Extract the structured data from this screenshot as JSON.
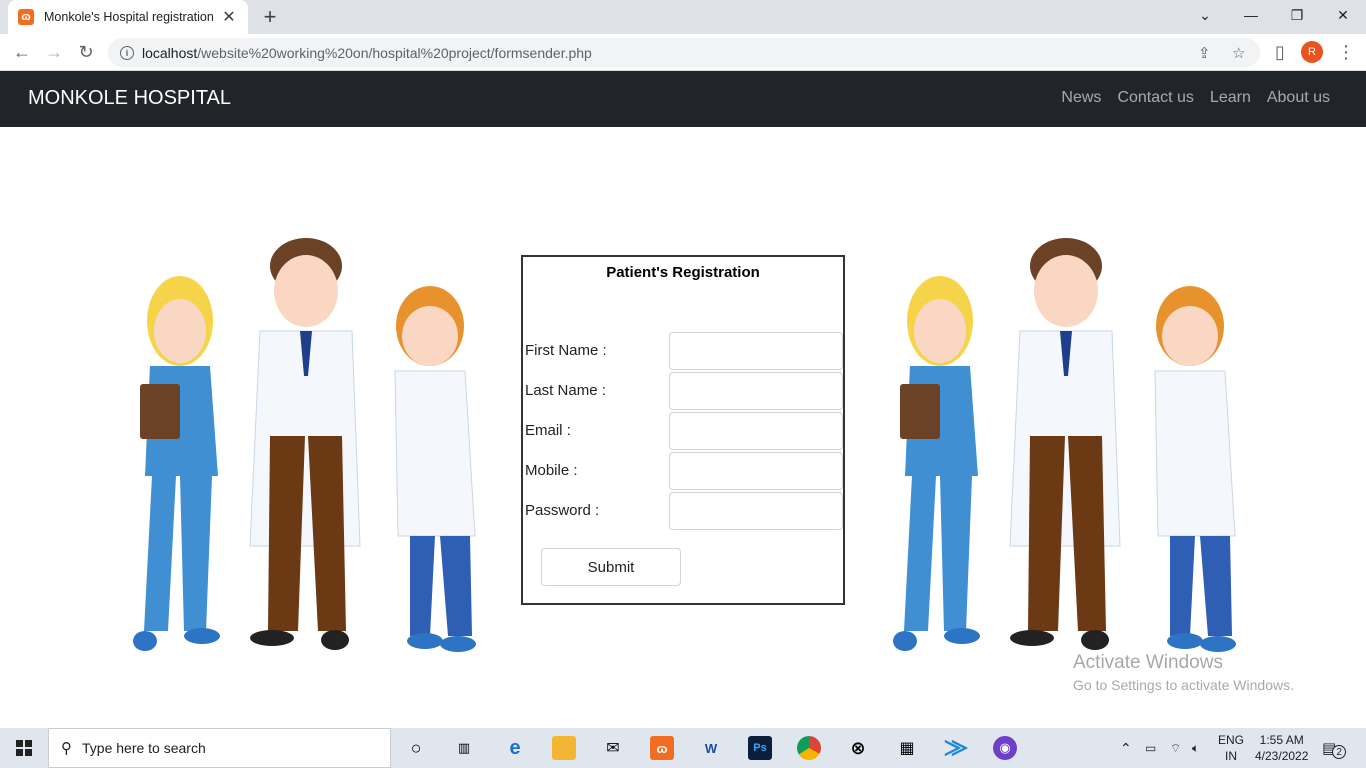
{
  "browser": {
    "tab_title": "Monkole's Hospital registration",
    "tab_close": "✕",
    "new_tab": "+",
    "url_host": "localhost",
    "url_path": "/website%20working%20on/hospital%20project/formsender.php",
    "profile_initial": "R"
  },
  "navbar": {
    "brand": "MONKOLE HOSPITAL",
    "links": [
      "News",
      "Contact us",
      "Learn",
      "About us"
    ]
  },
  "form": {
    "title": "Patient's Registration",
    "fields": [
      {
        "label": "First Name :",
        "value": ""
      },
      {
        "label": "Last Name :",
        "value": ""
      },
      {
        "label": "Email :",
        "value": ""
      },
      {
        "label": "Mobile :",
        "value": ""
      },
      {
        "label": "Password :",
        "value": ""
      }
    ],
    "submit_label": "Submit"
  },
  "watermark": {
    "line1": "Activate Windows",
    "line2": "Go to Settings to activate Windows."
  },
  "taskbar": {
    "search_placeholder": "Type here to search",
    "language": "ENG",
    "region": "IN",
    "time": "1:55 AM",
    "date": "4/23/2022",
    "notification_count": "2"
  },
  "colors": {
    "navbar_bg": "#212529",
    "scrubs_blue": "#3f8fd2",
    "coat_white": "#f4f8fc"
  }
}
